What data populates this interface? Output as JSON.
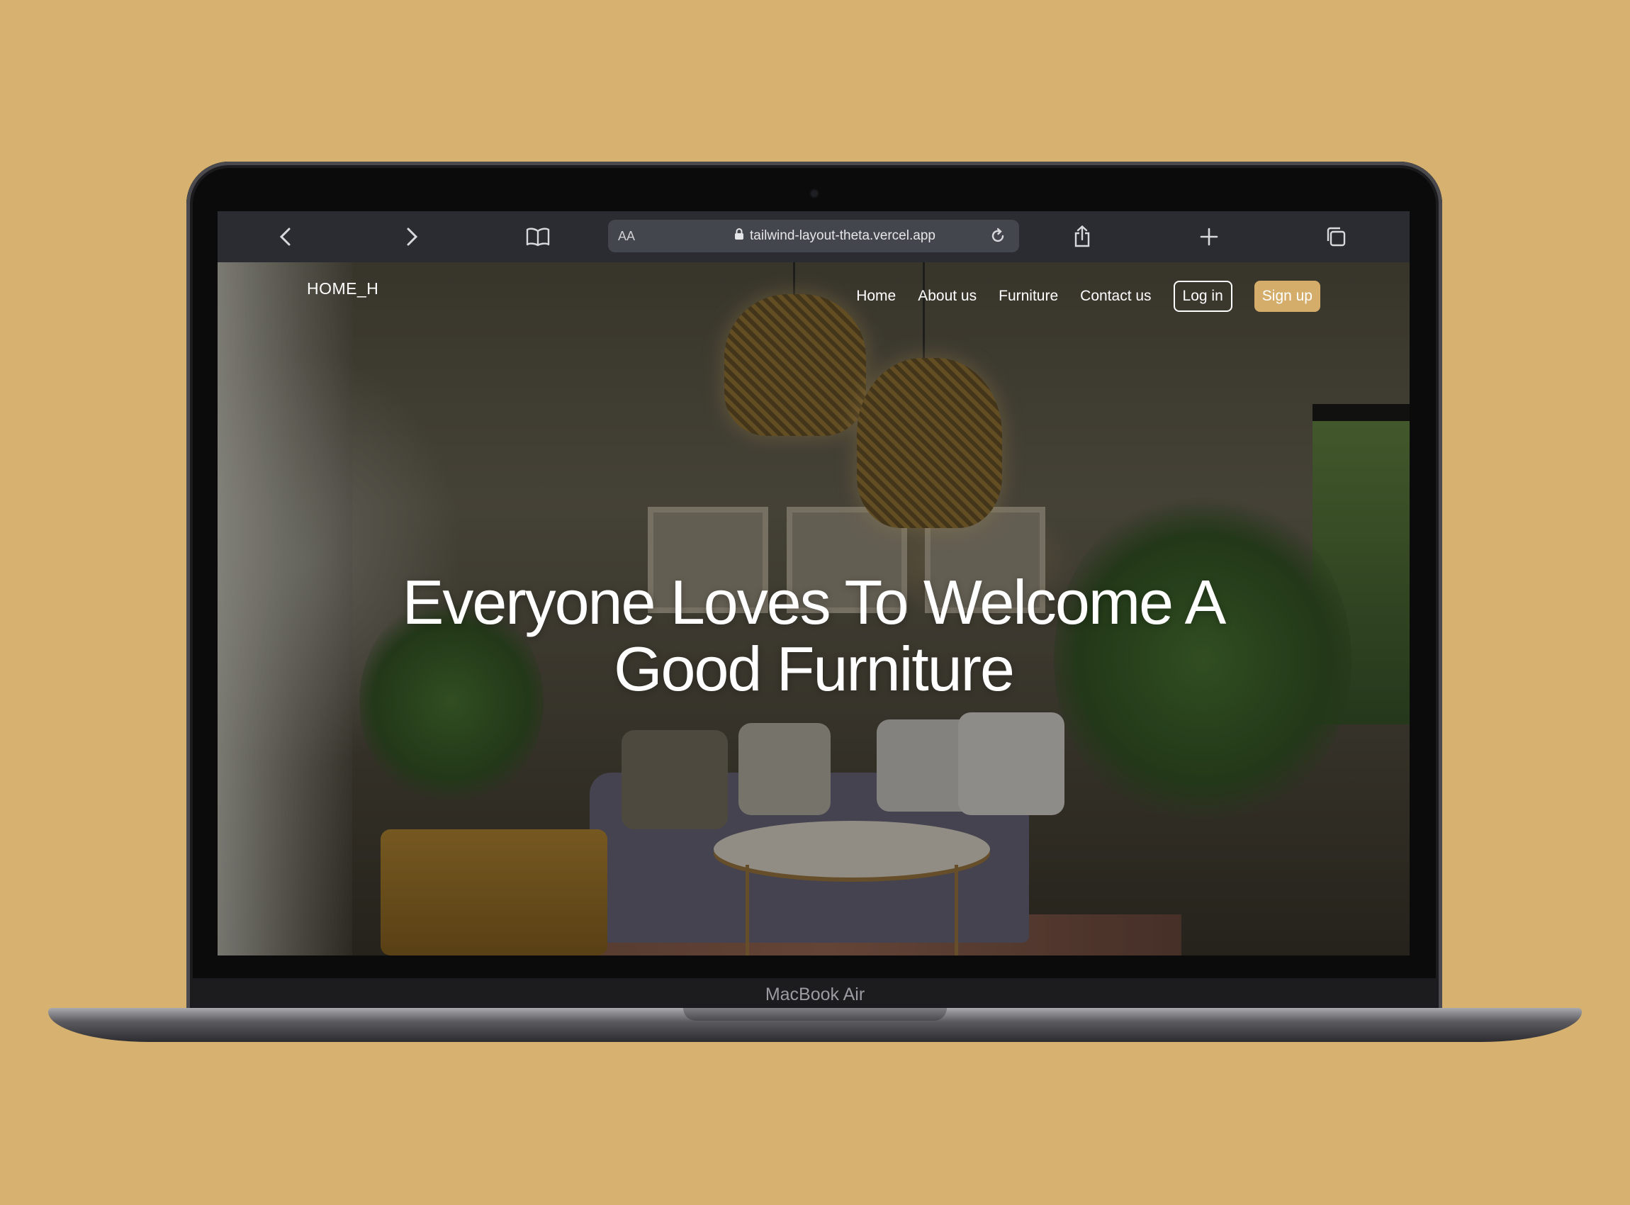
{
  "browser": {
    "text_size_label": "AA",
    "url": "tailwind-layout-theta.vercel.app",
    "icons": [
      "back-arrow-icon",
      "forward-arrow-icon",
      "bookmarks-book-icon",
      "lock-icon",
      "reload-icon",
      "share-icon",
      "plus-icon",
      "tabs-overview-icon"
    ]
  },
  "site": {
    "logo": "HOME_H",
    "nav": {
      "home": "Home",
      "about": "About us",
      "furniture": "Furniture",
      "contact": "Contact us"
    },
    "login_label": "Log in",
    "signup_label": "Sign up",
    "hero_line1": "Everyone Loves To Welcome A",
    "hero_line2": "Good Furniture"
  },
  "device": {
    "model": "MacBook Air"
  },
  "colors": {
    "background": "#d6b16f",
    "accent": "#d4ad6a",
    "toolbar": "#2a2c31"
  }
}
